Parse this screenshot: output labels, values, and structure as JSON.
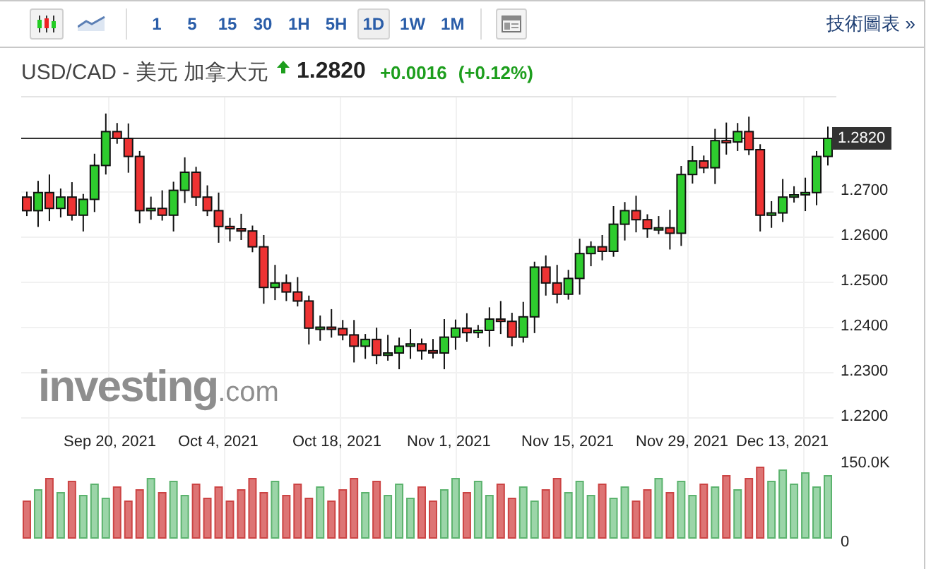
{
  "toolbar": {
    "chart_types": [
      {
        "kind": "candles",
        "selected": true
      },
      {
        "kind": "line",
        "selected": false
      }
    ],
    "intervals": [
      {
        "label": "1",
        "selected": false
      },
      {
        "label": "5",
        "selected": false
      },
      {
        "label": "15",
        "selected": false
      },
      {
        "label": "30",
        "selected": false
      },
      {
        "label": "1H",
        "selected": false
      },
      {
        "label": "5H",
        "selected": false
      },
      {
        "label": "1D",
        "selected": true
      },
      {
        "label": "1W",
        "selected": false
      },
      {
        "label": "1M",
        "selected": false
      }
    ],
    "link": "技術圖表 »"
  },
  "quote": {
    "title": "USD/CAD - 美元 加拿大元",
    "rising": true,
    "price": "1.2820",
    "change": "+0.0016",
    "change_percent": "(+0.12%)"
  },
  "chart": {
    "current_price": "1.2820",
    "y_axis_labels": [
      "1.2700",
      "1.2600",
      "1.2500",
      "1.2400",
      "1.2300",
      "1.2200"
    ],
    "x_axis_labels": [
      "Sep 20, 2021",
      "Oct 4, 2021",
      "Oct 18, 2021",
      "Nov 1, 2021",
      "Nov 15, 2021",
      "Nov 29, 2021",
      "Dec 13, 2021"
    ],
    "volume_axis_labels": [
      "150.0K",
      "0"
    ],
    "logo": {
      "name": "investing",
      "suffix": ".com"
    }
  }
}
